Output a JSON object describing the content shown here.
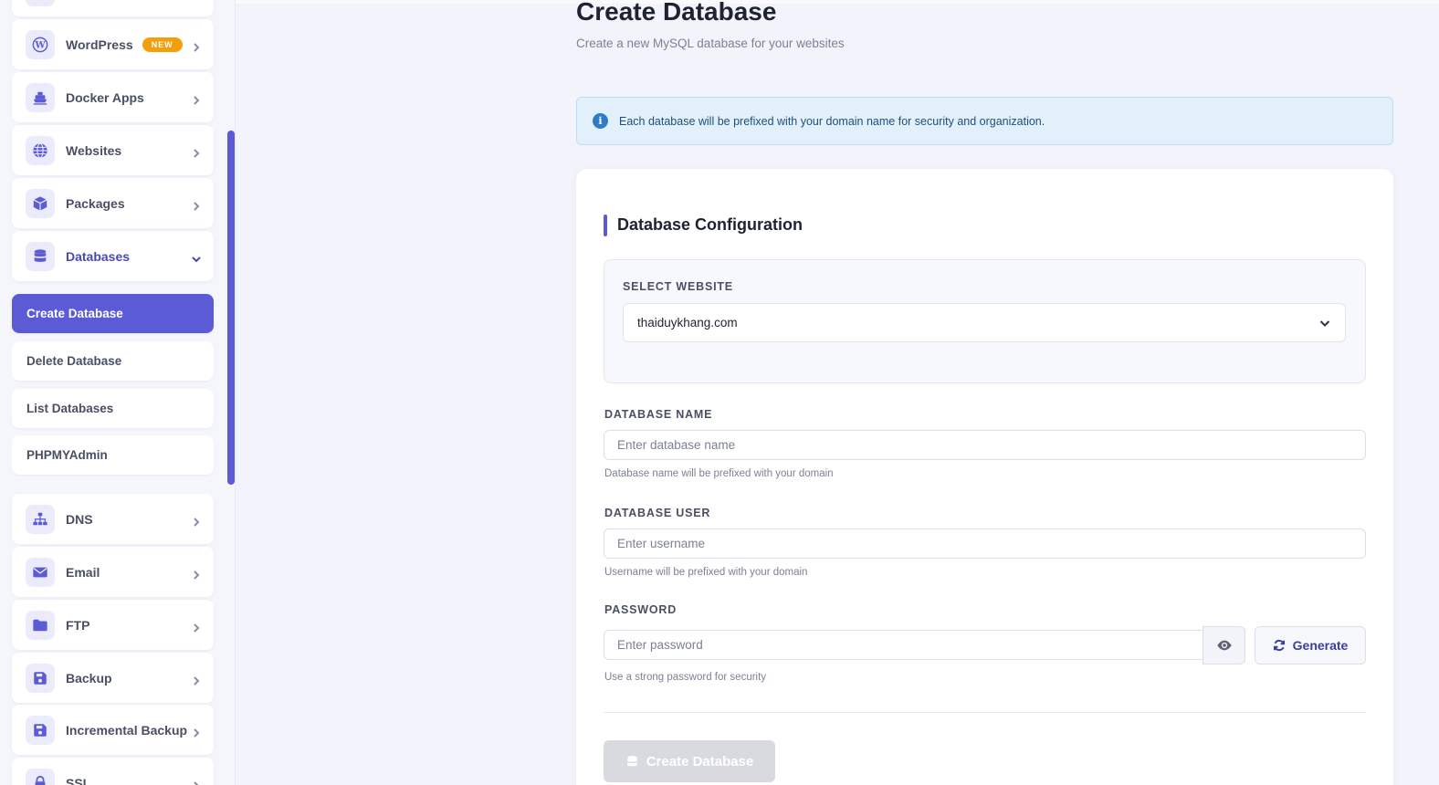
{
  "sidebar": {
    "items_top": [
      {
        "label": "WordPress",
        "icon": "wordpress-icon",
        "badge": "NEW"
      },
      {
        "label": "Docker Apps",
        "icon": "ship-icon"
      },
      {
        "label": "Websites",
        "icon": "globe-icon"
      },
      {
        "label": "Packages",
        "icon": "box-icon"
      },
      {
        "label": "Databases",
        "icon": "database-icon"
      }
    ],
    "sub_items": [
      {
        "label": "Create Database"
      },
      {
        "label": "Delete Database"
      },
      {
        "label": "List Databases"
      },
      {
        "label": "PHPMYAdmin"
      }
    ],
    "items_bottom": [
      {
        "label": "DNS",
        "icon": "sitemap-icon"
      },
      {
        "label": "Email",
        "icon": "envelope-icon"
      },
      {
        "label": "FTP",
        "icon": "folder-icon"
      },
      {
        "label": "Backup",
        "icon": "save-icon"
      },
      {
        "label": "Incremental Backup",
        "icon": "save-icon"
      },
      {
        "label": "SSL",
        "icon": "lock-icon"
      }
    ]
  },
  "header": {
    "title": "Create Database",
    "subtitle": "Create a new MySQL database for your websites"
  },
  "info": {
    "text": "Each database will be prefixed with your domain name for security and organization."
  },
  "form": {
    "section_title": "Database Configuration",
    "website_label": "SELECT WEBSITE",
    "website_value": "thaiduykhang.com",
    "dbname_label": "DATABASE NAME",
    "dbname_placeholder": "Enter database name",
    "dbname_help": "Database name will be prefixed with your domain",
    "dbuser_label": "DATABASE USER",
    "dbuser_placeholder": "Enter username",
    "dbuser_help": "Username will be prefixed with your domain",
    "password_label": "PASSWORD",
    "password_placeholder": "Enter password",
    "password_help": "Use a strong password for security",
    "generate_label": "Generate",
    "submit_label": "Create Database"
  },
  "colors": {
    "accent": "#5b5bd6",
    "badge": "#f59e0b",
    "info_bg": "#e2f0fb"
  }
}
